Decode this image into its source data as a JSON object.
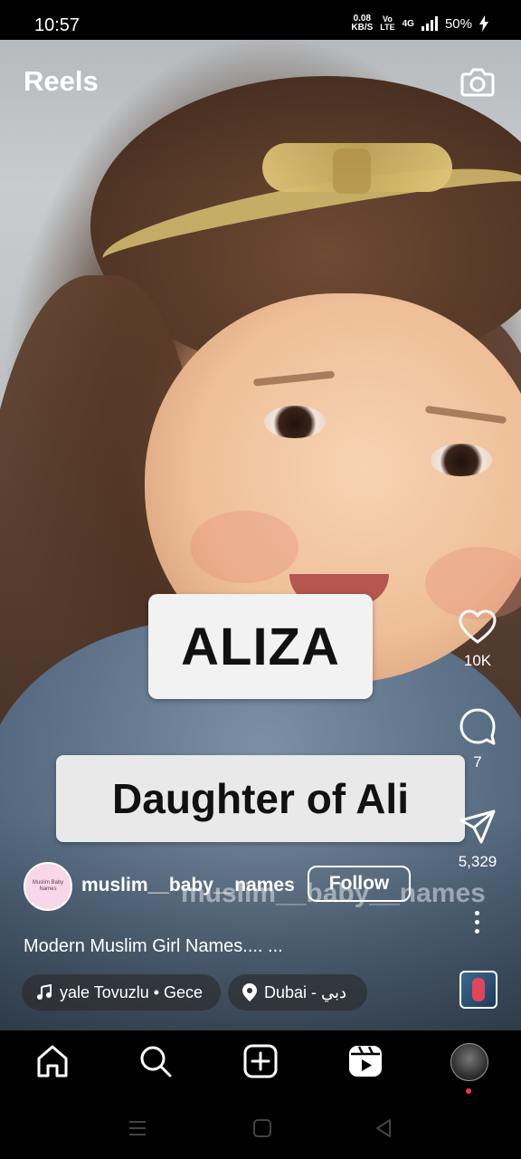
{
  "status_bar": {
    "time": "10:57",
    "speed_value": "0.08",
    "speed_unit": "KB/S",
    "volte_top": "Vo",
    "volte_bottom": "LTE",
    "network": "4G",
    "battery": "50%"
  },
  "header": {
    "title": "Reels",
    "camera_icon": "camera-icon"
  },
  "overlay": {
    "name": "ALIZA",
    "meaning": "Daughter of Ali",
    "watermark": "muslim__baby__names"
  },
  "actions": {
    "like_count": "10K",
    "comment_count": "7",
    "share_count": "5,329"
  },
  "post": {
    "avatar_text_1": "Muslim Baby",
    "avatar_text_2": "Names",
    "username": "muslim__baby__names",
    "follow_label": "Follow",
    "caption": "Modern Muslim Girl Names.... ...",
    "audio_label": "yale Tovuzlu • Gece",
    "location_label": "Dubai - دبي"
  },
  "colors": {
    "background": "#000000",
    "text": "#ffffff",
    "notification_dot": "#ff3040"
  }
}
